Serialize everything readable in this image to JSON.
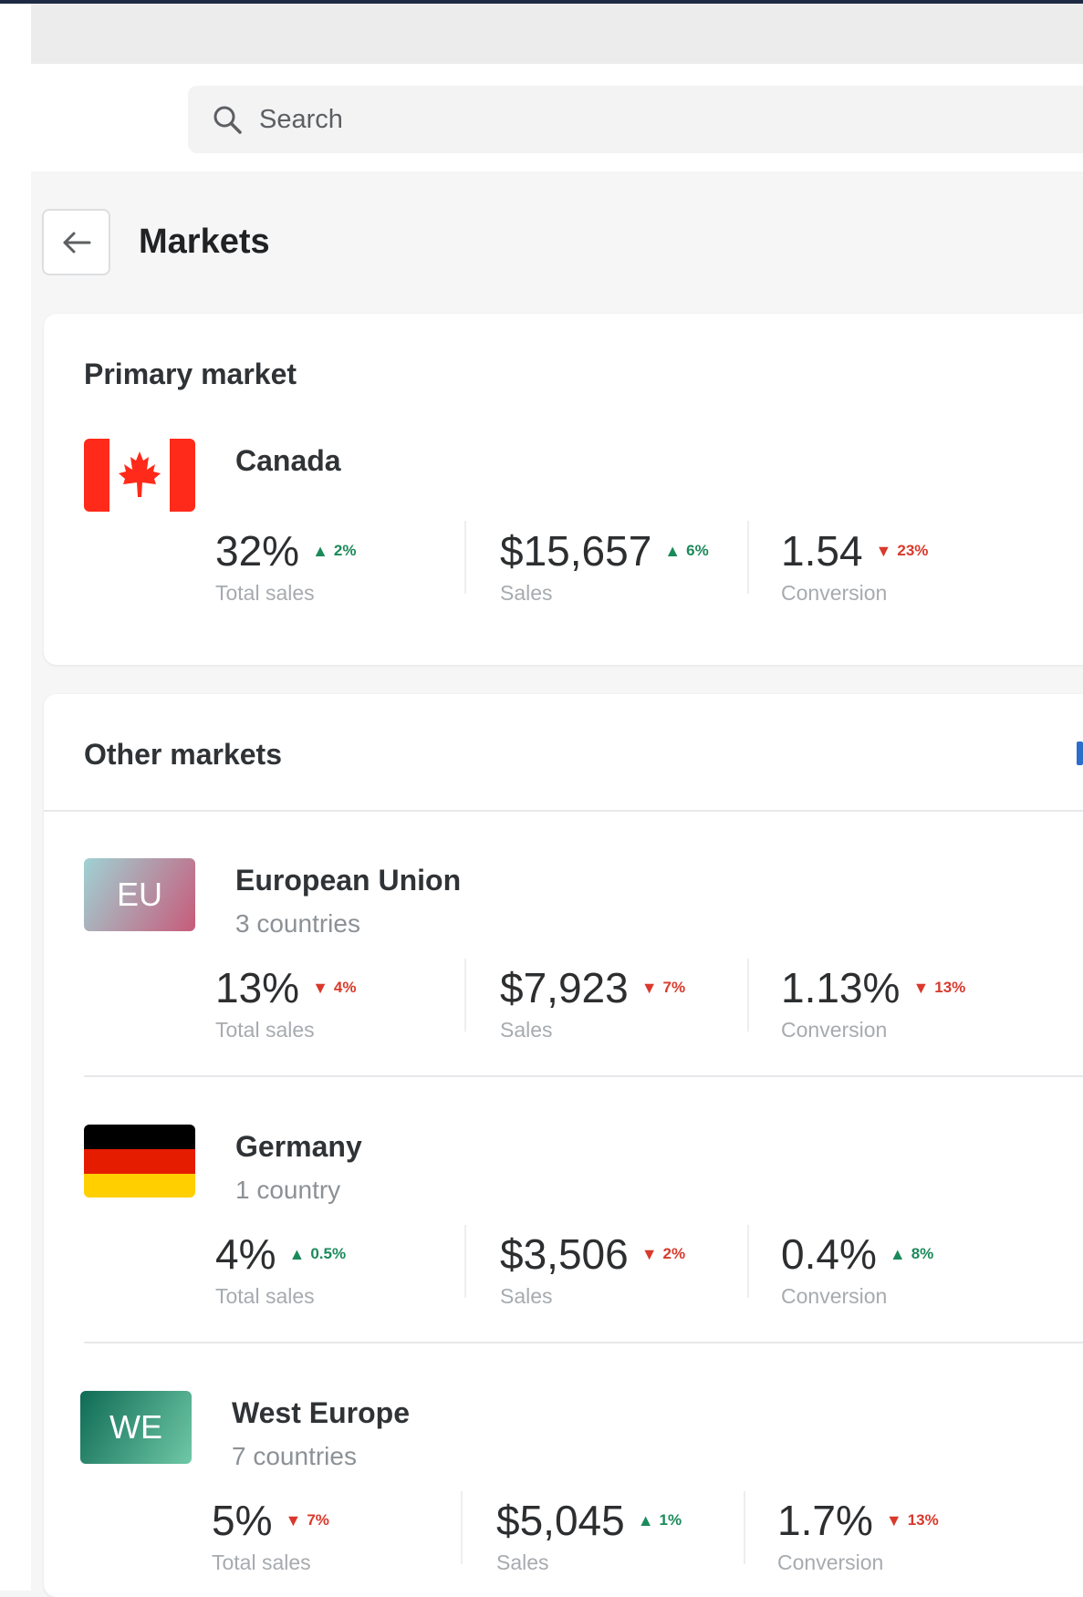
{
  "search": {
    "placeholder": "Search"
  },
  "page": {
    "title": "Markets"
  },
  "primary": {
    "heading": "Primary market",
    "market": {
      "name": "Canada",
      "metrics": [
        {
          "value": "32%",
          "change": "2%",
          "direction": "up",
          "label": "Total sales"
        },
        {
          "value": "$15,657",
          "change": "6%",
          "direction": "up",
          "label": "Sales"
        },
        {
          "value": "1.54",
          "change": "23%",
          "direction": "down",
          "label": "Conversion"
        }
      ]
    }
  },
  "other": {
    "heading": "Other markets",
    "markets": [
      {
        "name": "European Union",
        "badge": "EU",
        "sub": "3 countries",
        "metrics": [
          {
            "value": "13%",
            "change": "4%",
            "direction": "down",
            "label": "Total sales"
          },
          {
            "value": "$7,923",
            "change": "7%",
            "direction": "down",
            "label": "Sales"
          },
          {
            "value": "1.13%",
            "change": "13%",
            "direction": "down",
            "label": "Conversion"
          }
        ]
      },
      {
        "name": "Germany",
        "sub": "1 country",
        "metrics": [
          {
            "value": "4%",
            "change": "0.5%",
            "direction": "up",
            "label": "Total sales"
          },
          {
            "value": "$3,506",
            "change": "2%",
            "direction": "down",
            "label": "Sales"
          },
          {
            "value": "0.4%",
            "change": "8%",
            "direction": "up",
            "label": "Conversion"
          }
        ]
      },
      {
        "name": "West Europe",
        "badge": "WE",
        "sub": "7 countries",
        "metrics": [
          {
            "value": "5%",
            "change": "7%",
            "direction": "down",
            "label": "Total sales"
          },
          {
            "value": "$5,045",
            "change": "1%",
            "direction": "up",
            "label": "Sales"
          },
          {
            "value": "1.7%",
            "change": "13%",
            "direction": "down",
            "label": "Conversion"
          }
        ]
      }
    ]
  },
  "colors": {
    "up": "#1b8a5a",
    "down": "#d9392b",
    "link": "#2c6ecb"
  },
  "icons": {
    "search": "search-icon",
    "back": "arrow-left-icon",
    "up": "triangle-up-icon",
    "down": "triangle-down-icon"
  }
}
